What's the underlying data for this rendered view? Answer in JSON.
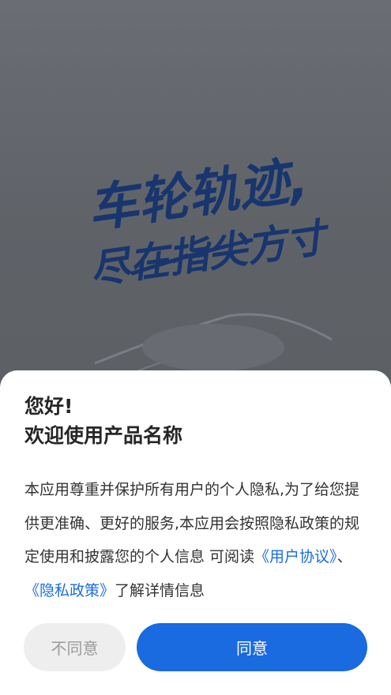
{
  "slogan": {
    "line1": "车轮轨迹,",
    "line2": "尽在指尖方寸"
  },
  "dialog": {
    "greeting": "您好!",
    "welcome": "欢迎使用产品名称",
    "notice_part1": "本应用尊重并保护所有用户的个人隐私,为了给您提供更准确、更好的服务,本应用会按照隐私政策的规定使用和披露您的个人信息 可阅读",
    "user_agreement_link": "《用户协议》",
    "separator": "、",
    "privacy_policy_link": "《隐私政策》",
    "notice_part2": "了解详情信息",
    "decline_label": "不同意",
    "agree_label": "同意"
  },
  "colors": {
    "slogan": "#18356e",
    "link": "#1a6de0",
    "agree_button": "#1a6ae0",
    "decline_button": "#eeeeee",
    "backdrop": "#606368"
  }
}
